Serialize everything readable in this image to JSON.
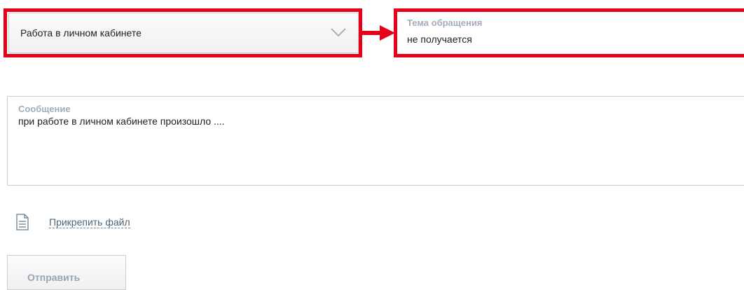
{
  "category_select": {
    "selected_value": "Работа в личном кабинете",
    "icon": "chevron-down-icon"
  },
  "subject_field": {
    "label": "Тема обращения",
    "value": "не получается"
  },
  "message_field": {
    "label": "Сообщение",
    "value": "при работе в личном кабинете произошло ...."
  },
  "attach": {
    "icon": "file-icon",
    "link_label": "Прикрепить файл"
  },
  "submit_button": {
    "label": "Отправить"
  },
  "annotations": {
    "highlight_color": "#e6001a",
    "arrow_direction": "right"
  },
  "colors": {
    "label": "#a3acb9",
    "border": "#c9cfd6",
    "link": "#4d6477"
  }
}
